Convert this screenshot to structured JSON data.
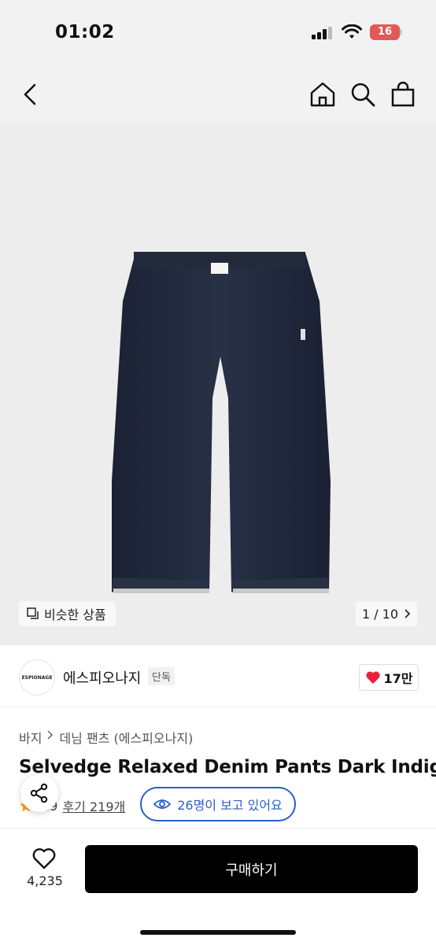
{
  "status_bar": {
    "time": "01:02",
    "battery": "16"
  },
  "hero": {
    "similar_label": "비슷한 상품",
    "pager": "1 / 10"
  },
  "brand": {
    "logo_text": "ESPIONAGE",
    "name": "에스피오나지",
    "tag": "단독",
    "likes": "17만"
  },
  "breadcrumb": {
    "category": "바지",
    "subcategory": "데님 팬츠 (에스피오나지)"
  },
  "product": {
    "title": "Selvedge Relaxed Denim Pants Dark Indigo",
    "rating": "4.9",
    "reviews": "후기 219개",
    "watching": "26명이 보고 있어요"
  },
  "bottom_bar": {
    "wish_count": "4,235",
    "buy_label": "구매하기"
  },
  "colors": {
    "accent_blue": "#2b5fc9",
    "heart_red": "#e8223a",
    "star": "#f5a623"
  },
  "icons": [
    "back-icon",
    "home-icon",
    "search-icon",
    "bag-icon",
    "similar-icon",
    "chevron-right-icon",
    "heart-icon",
    "eye-icon",
    "share-icon",
    "star-icon"
  ]
}
